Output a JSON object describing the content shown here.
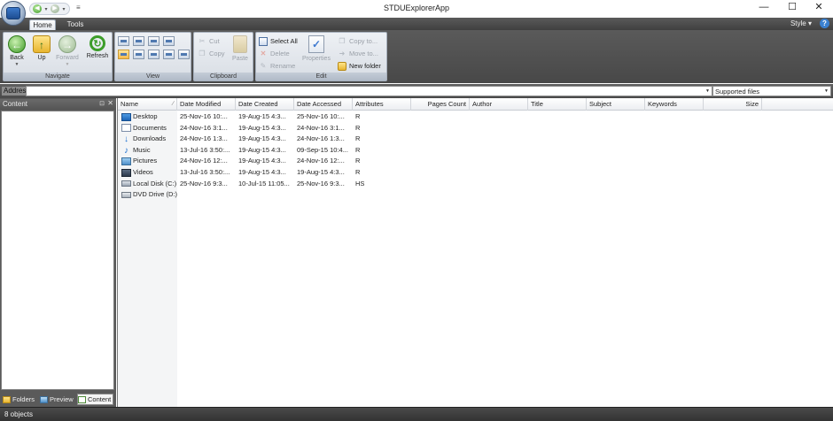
{
  "window": {
    "title": "STDUExplorerApp",
    "minimize": "—",
    "maximize": "☐",
    "close": "✕"
  },
  "quick_access": {
    "back": "◀",
    "forward": "▶",
    "dropdown": "▾",
    "customize": "≡"
  },
  "ribbon": {
    "tabs": [
      {
        "label": "Home",
        "active": true
      },
      {
        "label": "Tools",
        "active": false
      }
    ],
    "style_label": "Style",
    "style_arrow": "▾",
    "help": "?",
    "groups": {
      "navigate": {
        "label": "Navigate",
        "back": "Back",
        "up": "Up",
        "forward": "Forward",
        "refresh": "Refresh"
      },
      "view": {
        "label": "View"
      },
      "clipboard": {
        "label": "Clipboard",
        "cut": "Cut",
        "copy": "Copy",
        "paste": "Paste"
      },
      "edit": {
        "label": "Edit",
        "select_all": "Select All",
        "delete": "Delete",
        "rename": "Rename",
        "properties": "Properties",
        "copy_to": "Copy to...",
        "move_to": "Move to...",
        "new_folder": "New folder"
      }
    }
  },
  "address_bar": {
    "label": "Address",
    "value": "",
    "filter": "Supported files"
  },
  "left_pane": {
    "title": "Content",
    "tabs": [
      {
        "label": "Folders",
        "active": false
      },
      {
        "label": "Preview",
        "active": false
      },
      {
        "label": "Content",
        "active": true
      }
    ]
  },
  "file_list": {
    "columns": [
      "Name",
      "Date Modified",
      "Date Created",
      "Date Accessed",
      "Attributes",
      "Pages Count",
      "Author",
      "Title",
      "Subject",
      "Keywords",
      "Size"
    ],
    "rows": [
      {
        "icon": "desktop-icon",
        "name": "Desktop",
        "modified": "25-Nov-16 10:...",
        "created": "19-Aug-15 4:3...",
        "accessed": "25-Nov-16 10:...",
        "attributes": "R"
      },
      {
        "icon": "documents-icon",
        "name": "Documents",
        "modified": "24-Nov-16 3:1...",
        "created": "19-Aug-15 4:3...",
        "accessed": "24-Nov-16 3:1...",
        "attributes": "R"
      },
      {
        "icon": "downloads-icon",
        "name": "Downloads",
        "modified": "24-Nov-16 1:3...",
        "created": "19-Aug-15 4:3...",
        "accessed": "24-Nov-16 1:3...",
        "attributes": "R"
      },
      {
        "icon": "music-icon",
        "name": "Music",
        "modified": "13-Jul-16 3:50:...",
        "created": "19-Aug-15 4:3...",
        "accessed": "09-Sep-15 10:4...",
        "attributes": "R"
      },
      {
        "icon": "pictures-icon",
        "name": "Pictures",
        "modified": "24-Nov-16 12:...",
        "created": "19-Aug-15 4:3...",
        "accessed": "24-Nov-16 12:...",
        "attributes": "R"
      },
      {
        "icon": "videos-icon",
        "name": "Videos",
        "modified": "13-Jul-16 3:50:...",
        "created": "19-Aug-15 4:3...",
        "accessed": "19-Aug-15 4:3...",
        "attributes": "R"
      },
      {
        "icon": "local-disk-icon",
        "name": "Local Disk (C:)",
        "modified": "25-Nov-16 9:3...",
        "created": "10-Jul-15 11:05...",
        "accessed": "25-Nov-16 9:3...",
        "attributes": "HS"
      },
      {
        "icon": "dvd-drive-icon",
        "name": "DVD Drive (D:)",
        "modified": "",
        "created": "",
        "accessed": "",
        "attributes": ""
      }
    ]
  },
  "status": {
    "text": "8 objects"
  }
}
